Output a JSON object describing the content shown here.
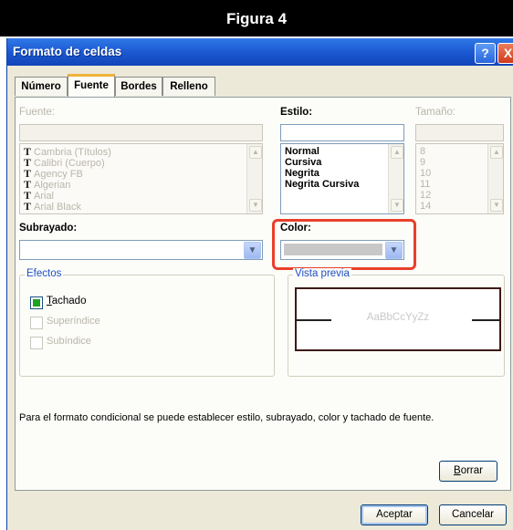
{
  "figure": {
    "caption": "Figura 4"
  },
  "window": {
    "title": "Formato de celdas",
    "help_label": "?",
    "close_label": "X"
  },
  "tabs": [
    {
      "label": "Número",
      "active": false
    },
    {
      "label": "Fuente",
      "active": true
    },
    {
      "label": "Bordes",
      "active": false
    },
    {
      "label": "Relleno",
      "active": false
    }
  ],
  "font": {
    "fuente_label": "Fuente:",
    "fuente_value": "",
    "fuente_items": [
      {
        "icon": "T",
        "label": "Cambria (Títulos)"
      },
      {
        "icon": "T",
        "label": "Calibri (Cuerpo)"
      },
      {
        "icon": "T",
        "label": "Agency FB"
      },
      {
        "icon": "T",
        "label": "Algerian"
      },
      {
        "icon": "T",
        "label": "Arial"
      },
      {
        "icon": "T",
        "label": "Arial Black"
      }
    ],
    "estilo_label": "Estilo:",
    "estilo_value": "",
    "estilo_items": [
      "Normal",
      "Cursiva",
      "Negrita",
      "Negrita Cursiva"
    ],
    "tamano_label": "Tamaño:",
    "tamano_value": "",
    "tamano_items": [
      "8",
      "9",
      "10",
      "11",
      "12",
      "14"
    ],
    "subrayado_label": "Subrayado:",
    "subrayado_value": "",
    "color_label": "Color:",
    "color_swatch": "#c8c8c8"
  },
  "effects": {
    "title": "Efectos",
    "items": [
      {
        "label_first": "T",
        "label_rest": "achado",
        "checked": true,
        "enabled": true
      },
      {
        "label_first": "",
        "label_rest": "Superíndice",
        "checked": false,
        "enabled": false
      },
      {
        "label_first": "",
        "label_rest": "Subíndice",
        "checked": false,
        "enabled": false
      }
    ]
  },
  "preview": {
    "title": "Vista previa",
    "sample": "AaBbCcYyZz"
  },
  "note": "Para el formato condicional se puede establecer estilo, subrayado, color y tachado de fuente.",
  "buttons": {
    "borrar_first": "B",
    "borrar_rest": "orrar",
    "aceptar": "Aceptar",
    "cancelar": "Cancelar"
  },
  "colors": {
    "titlebar": "#1a56cf",
    "highlight": "#e8402b",
    "dialog_bg": "#ece9d8"
  }
}
